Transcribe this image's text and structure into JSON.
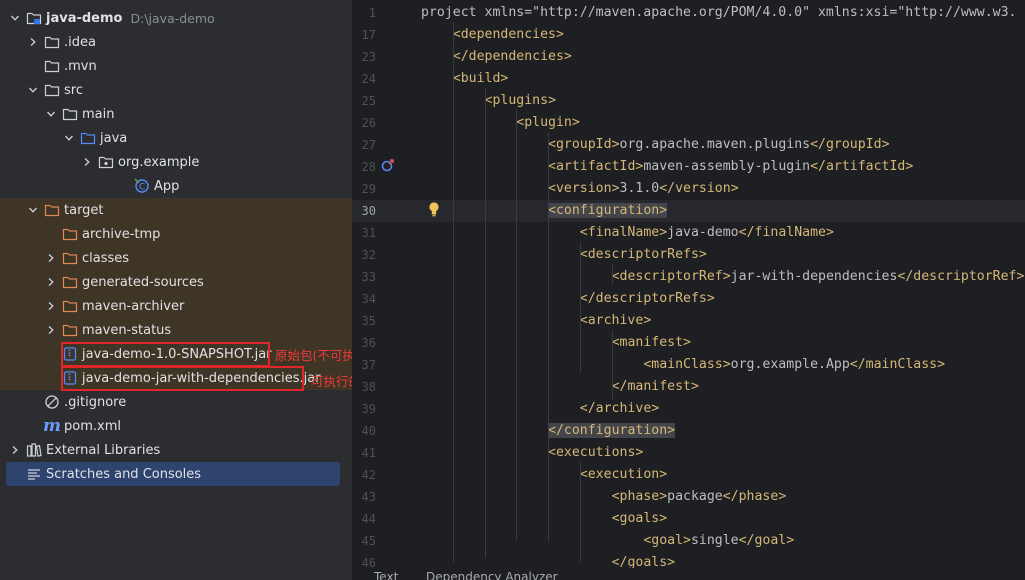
{
  "tree": {
    "items": [
      {
        "label": "java-demo",
        "path": "D:\\java-demo",
        "bold": true
      },
      {
        "label": ".idea"
      },
      {
        "label": ".mvn"
      },
      {
        "label": "src"
      },
      {
        "label": "main"
      },
      {
        "label": "java"
      },
      {
        "label": "org.example"
      },
      {
        "label": "App"
      },
      {
        "label": "target"
      },
      {
        "label": "archive-tmp"
      },
      {
        "label": "classes"
      },
      {
        "label": "generated-sources"
      },
      {
        "label": "maven-archiver"
      },
      {
        "label": "maven-status"
      },
      {
        "label": "java-demo-1.0-SNAPSHOT.jar"
      },
      {
        "label": "java-demo-jar-with-dependencies.jar"
      },
      {
        "label": ".gitignore"
      },
      {
        "label": "pom.xml"
      },
      {
        "label": "External Libraries"
      },
      {
        "label": "Scratches and Consoles"
      }
    ],
    "annotations": {
      "original_jar": "原始包(不可执行)",
      "fat_jar": "可执行的fat包"
    }
  },
  "editor": {
    "lines": [
      {
        "n": "1",
        "text": "<project xmlns=\"http://maven.apache.org/POM/4.0.0\" xmlns:xsi=\"http://www.w3."
      },
      {
        "n": "17",
        "text": "    <dependencies>"
      },
      {
        "n": "23",
        "text": "    </dependencies>"
      },
      {
        "n": "24",
        "text": "    <build>"
      },
      {
        "n": "25",
        "text": "        <plugins>"
      },
      {
        "n": "26",
        "text": "            <plugin>"
      },
      {
        "n": "27",
        "text": "                <groupId>org.apache.maven.plugins</groupId>"
      },
      {
        "n": "28",
        "text": "                <artifactId>maven-assembly-plugin</artifactId>"
      },
      {
        "n": "29",
        "text": "                <version>3.1.0</version>"
      },
      {
        "n": "30",
        "text": "                <configuration>"
      },
      {
        "n": "31",
        "text": "                    <finalName>java-demo</finalName>"
      },
      {
        "n": "32",
        "text": "                    <descriptorRefs>"
      },
      {
        "n": "33",
        "text": "                        <descriptorRef>jar-with-dependencies</descriptorRef>"
      },
      {
        "n": "34",
        "text": "                    </descriptorRefs>"
      },
      {
        "n": "35",
        "text": "                    <archive>"
      },
      {
        "n": "36",
        "text": "                        <manifest>"
      },
      {
        "n": "37",
        "text": "                            <mainClass>org.example.App</mainClass>"
      },
      {
        "n": "38",
        "text": "                        </manifest>"
      },
      {
        "n": "39",
        "text": "                    </archive>"
      },
      {
        "n": "40",
        "text": "                </configuration>"
      },
      {
        "n": "41",
        "text": "                <executions>"
      },
      {
        "n": "42",
        "text": "                    <execution>"
      },
      {
        "n": "43",
        "text": "                        <phase>package</phase>"
      },
      {
        "n": "44",
        "text": "                        <goals>"
      },
      {
        "n": "45",
        "text": "                            <goal>single</goal>"
      },
      {
        "n": "46",
        "text": "                        </goals>"
      }
    ],
    "current_line": "30"
  },
  "bottom_tabs": [
    "Text",
    "Dependency Analyzer"
  ],
  "colors": {
    "tag": "#d5b778",
    "string": "#6aab73",
    "namespace": "#c77dbb",
    "text": "#bcbec4",
    "excluded_bg": "#3e3526",
    "selected_bg": "#2e436e",
    "annotation": "#f03a3a"
  }
}
